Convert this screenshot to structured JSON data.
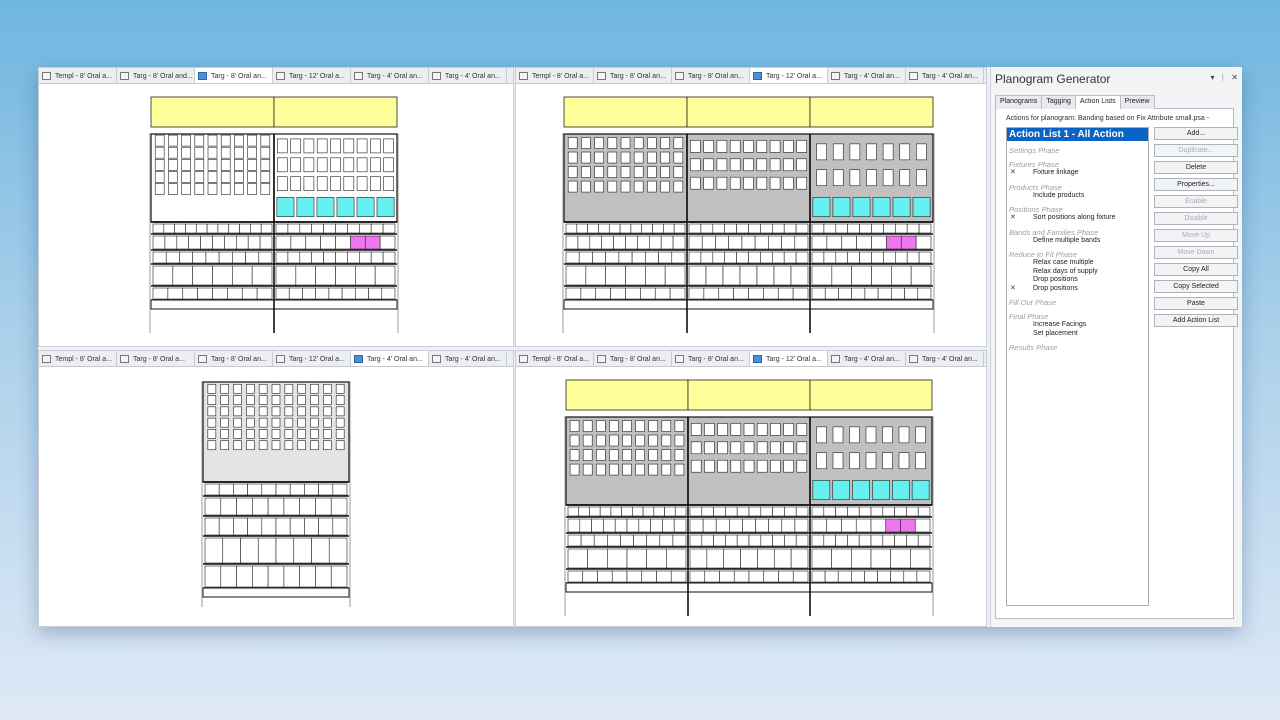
{
  "panes": [
    {
      "id": "pane-1",
      "tabs": [
        {
          "label": "Templ - 8' Oral a...",
          "active": false
        },
        {
          "label": "Targ - 8' Oral and...",
          "active": false
        },
        {
          "label": "Targ - 8' Oral an...",
          "active": true
        },
        {
          "label": "Targ - 12' Oral a...",
          "active": false
        },
        {
          "label": "Targ - 4' Oral an...",
          "active": false
        },
        {
          "label": "Targ - 4' Oral an...",
          "active": false
        }
      ]
    },
    {
      "id": "pane-2",
      "tabs": [
        {
          "label": "Templ - 8' Oral a...",
          "active": false
        },
        {
          "label": "Targ - 8' Oral an...",
          "active": false
        },
        {
          "label": "Targ - 8' Oral an...",
          "active": false
        },
        {
          "label": "Targ - 12' Oral a...",
          "active": true
        },
        {
          "label": "Targ - 4' Oral an...",
          "active": false
        },
        {
          "label": "Targ - 4' Oral an...",
          "active": false
        }
      ]
    },
    {
      "id": "pane-3",
      "tabs": [
        {
          "label": "Templ - 8' Oral a...",
          "active": false
        },
        {
          "label": "Targ - 8' Oral a...",
          "active": false
        },
        {
          "label": "Targ - 8' Oral an...",
          "active": false
        },
        {
          "label": "Targ - 12' Oral a...",
          "active": false
        },
        {
          "label": "Targ - 4' Oral an...",
          "active": true
        },
        {
          "label": "Targ - 4' Oral an...",
          "active": false
        }
      ]
    },
    {
      "id": "pane-4",
      "tabs": [
        {
          "label": "Templ - 8' Oral a...",
          "active": false
        },
        {
          "label": "Targ - 8' Oral an...",
          "active": false
        },
        {
          "label": "Targ - 8' Oral an...",
          "active": false
        },
        {
          "label": "Targ - 12' Oral a...",
          "active": true
        },
        {
          "label": "Targ - 4' Oral an...",
          "active": false
        },
        {
          "label": "Targ - 4' Oral an...",
          "active": false
        }
      ]
    }
  ],
  "generator": {
    "title": "Planogram Generator",
    "controls": {
      "dropdown": "▾",
      "pin": "ᛁ",
      "close": "✕"
    },
    "tabs": [
      {
        "label": "Planograms",
        "active": false
      },
      {
        "label": "Tagging",
        "active": false
      },
      {
        "label": "Action Lists",
        "active": true
      },
      {
        "label": "Preview",
        "active": false
      }
    ],
    "caption": "Actions for planogram: Banding based on Fix Attribute small.psa -",
    "list_header": "Action List 1 - All Action",
    "phases": [
      {
        "name": "Settings Phase",
        "actions": []
      },
      {
        "name": "Fixtures Phase",
        "actions": [
          {
            "label": "Fixture linkage",
            "mark": "✕"
          }
        ]
      },
      {
        "name": "Products Phase",
        "actions": [
          {
            "label": "Include products",
            "mark": ""
          }
        ]
      },
      {
        "name": "Positions Phase",
        "actions": [
          {
            "label": "Sort positions along fixture",
            "mark": "✕"
          }
        ]
      },
      {
        "name": "Bands and Families Phase",
        "actions": [
          {
            "label": "Define multiple bands",
            "mark": ""
          }
        ]
      },
      {
        "name": "Reduce to Fit Phase",
        "actions": [
          {
            "label": "Relax case multiple",
            "mark": ""
          },
          {
            "label": "Relax days of supply",
            "mark": ""
          },
          {
            "label": "Drop positions",
            "mark": ""
          },
          {
            "label": "Drop positions",
            "mark": "✕"
          }
        ]
      },
      {
        "name": "Fill Out Phase",
        "actions": []
      },
      {
        "name": "Final Phase",
        "actions": [
          {
            "label": "Increase Facings",
            "mark": ""
          },
          {
            "label": "Set placement",
            "mark": ""
          }
        ]
      },
      {
        "name": "Results Phase",
        "actions": []
      }
    ],
    "buttons": [
      {
        "label": "Add...",
        "enabled": true
      },
      {
        "label": "Duplicate...",
        "enabled": false
      },
      {
        "label": "Delete",
        "enabled": true
      },
      {
        "label": "Properties...",
        "enabled": true
      },
      {
        "label": "Enable",
        "enabled": false
      },
      {
        "label": "Disable",
        "enabled": false
      },
      {
        "label": "Move Up",
        "enabled": false
      },
      {
        "label": "Move Down",
        "enabled": false
      },
      {
        "label": "Copy All",
        "enabled": true
      },
      {
        "label": "Copy Selected",
        "enabled": true
      },
      {
        "label": "Paste",
        "enabled": true
      },
      {
        "label": "Add Action List",
        "enabled": true
      }
    ]
  },
  "colors": {
    "header_fill": "#ffff99",
    "peg_fill": "#c0c0c0",
    "cyan": "#66f0f0",
    "magenta": "#ee77ee",
    "selection": "#0a64c8"
  }
}
